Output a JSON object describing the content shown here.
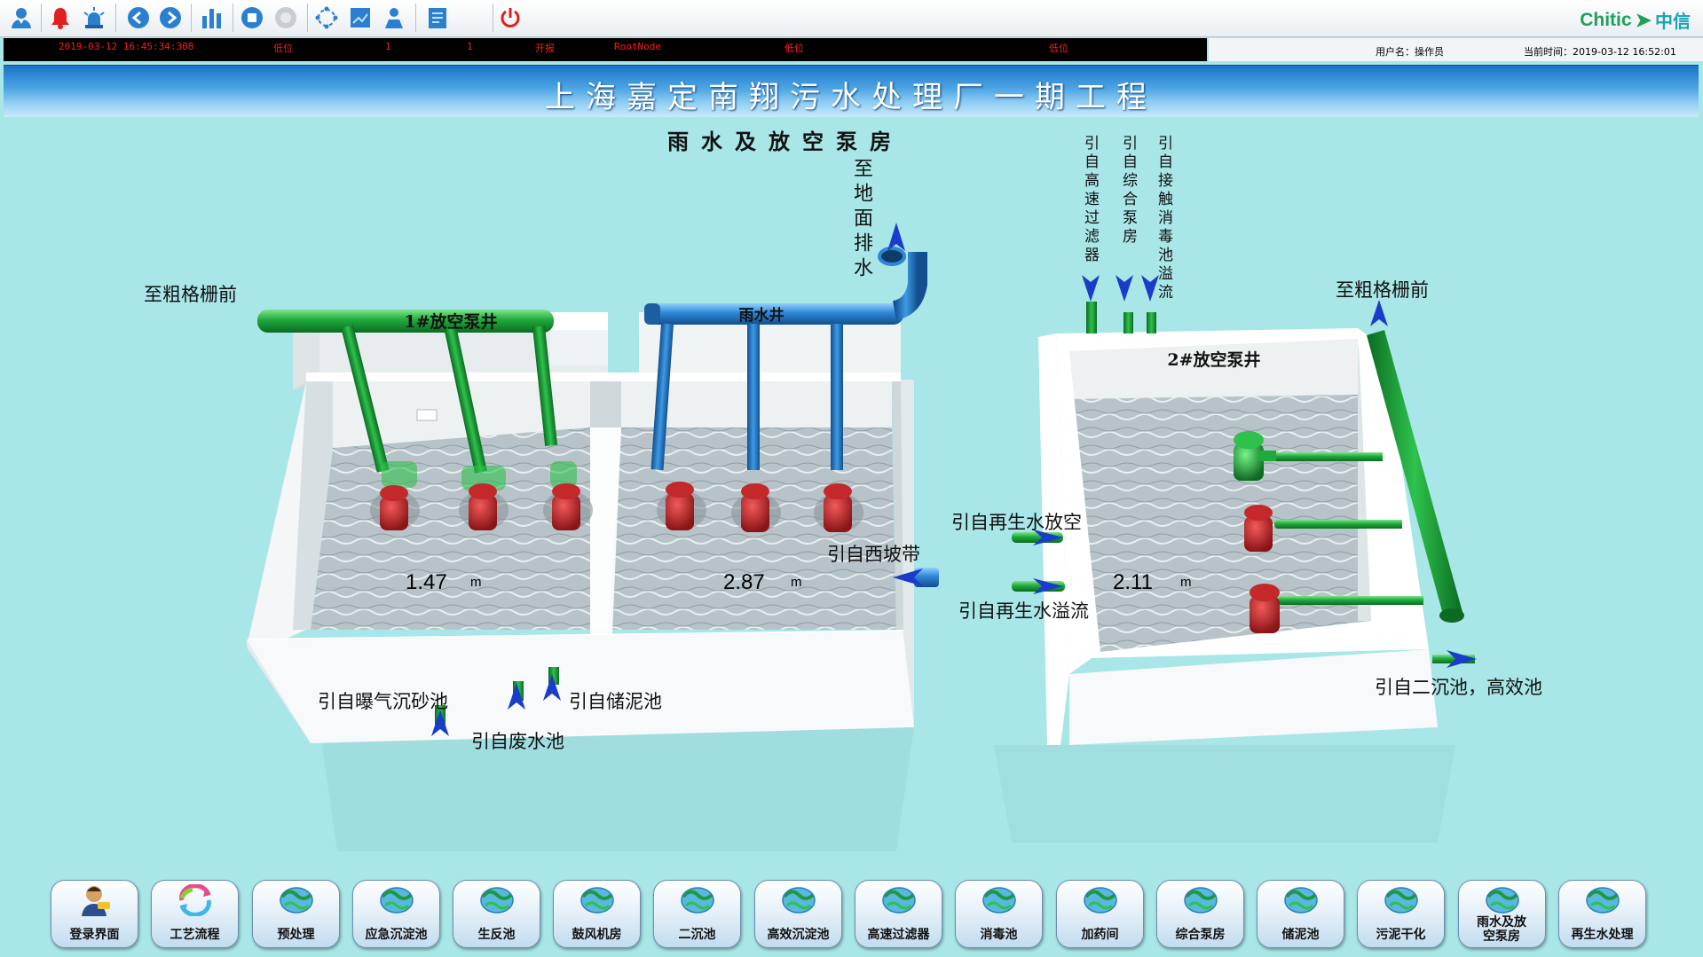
{
  "toolbar": {
    "logo_text": "Chitic",
    "logo_cn": "中信",
    "icons": [
      "user-icon",
      "alarm-bell-icon",
      "alarm-light-icon",
      "back-icon",
      "forward-icon",
      "bar-chart-icon",
      "stop-icon",
      "disabled-icon",
      "network-icon",
      "blueprint-icon",
      "operator-icon",
      "document-icon",
      "power-icon"
    ]
  },
  "alarm": {
    "time": "2019-03-12  16:45:34:308",
    "type": "低位",
    "col3": "1",
    "col4": "1",
    "state": "开报",
    "node": "RootNode",
    "level1": "低位",
    "level2": "低位"
  },
  "status": {
    "user": "用户名：操作员",
    "current_time": "当前时间：2019-03-12 16:52:01"
  },
  "header": {
    "title": "上海嘉定南翔污水处理厂一期工程",
    "page_title": "雨水及放空泵房"
  },
  "labels": {
    "to_coarse_screen_left": "至粗格栅前",
    "to_coarse_screen_right": "至粗格栅前",
    "to_surface_drain": "至地面排水",
    "from_high_speed_filter": "引自高速过滤器",
    "from_combined_pump": "引自综合泵房",
    "from_contact_disinfection": "引自接触消毒池溢流",
    "from_reclaimed_vent": "引自再生水放空",
    "from_xipo_belt": "引自西坡带",
    "from_reclaimed_overflow": "引自再生水溢流",
    "from_secondary_clarifier": "引自二沉池，高效池",
    "from_aerated_grit": "引自曝气沉砂池",
    "from_sludge_storage": "引自储泥池",
    "from_wastewater": "引自废水池",
    "well1": "1#放空泵井",
    "rain_well": "雨水井",
    "well2": "2#放空泵井"
  },
  "levels": {
    "well1": "1.47",
    "rain_well": "2.87",
    "well2": "2.11",
    "unit": "m"
  },
  "nav": [
    {
      "label": "登录界面",
      "icon": "login-icon"
    },
    {
      "label": "工艺流程",
      "icon": "process-flow-icon"
    },
    {
      "label": "预处理",
      "icon": "globe-icon"
    },
    {
      "label": "应急沉淀池",
      "icon": "globe-icon"
    },
    {
      "label": "生反池",
      "icon": "globe-icon"
    },
    {
      "label": "鼓风机房",
      "icon": "globe-icon"
    },
    {
      "label": "二沉池",
      "icon": "globe-icon"
    },
    {
      "label": "高效沉淀池",
      "icon": "globe-icon"
    },
    {
      "label": "高速过滤器",
      "icon": "globe-icon"
    },
    {
      "label": "消毒池",
      "icon": "globe-icon"
    },
    {
      "label": "加药间",
      "icon": "globe-icon"
    },
    {
      "label": "综合泵房",
      "icon": "globe-icon"
    },
    {
      "label": "储泥池",
      "icon": "globe-icon"
    },
    {
      "label": "污泥干化",
      "icon": "globe-icon"
    },
    {
      "label": "雨水及放空泵房",
      "icon": "globe-icon"
    },
    {
      "label": "再生水处理",
      "icon": "globe-icon"
    }
  ],
  "colors": {
    "background": "#a8e6e8",
    "alarm_text": "#ff1b1b",
    "green_pipe": "#1faa3c",
    "blue_pipe": "#2f86d6",
    "pump_red": "#c3282a",
    "arrow_blue": "#1a3cc8"
  }
}
